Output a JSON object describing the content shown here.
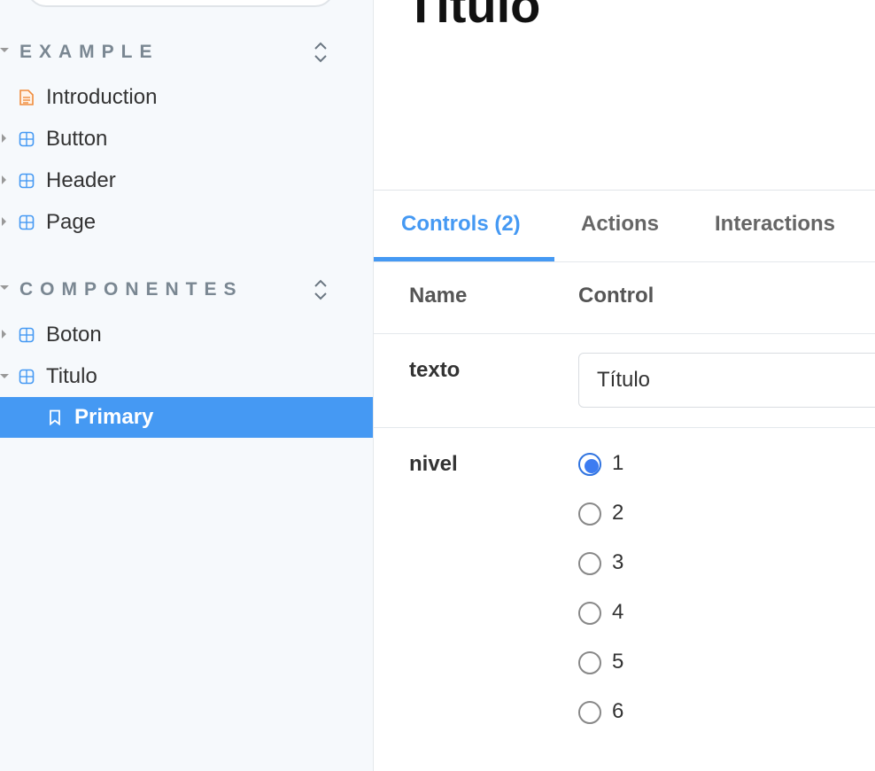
{
  "sidebar": {
    "groups": [
      {
        "title": "EXAMPLE",
        "items": [
          {
            "label": "Introduction",
            "type": "document-icon"
          },
          {
            "label": "Button",
            "type": "component-icon"
          },
          {
            "label": "Header",
            "type": "component-icon"
          },
          {
            "label": "Page",
            "type": "component-icon"
          }
        ]
      },
      {
        "title": "COMPONENTES",
        "items": [
          {
            "label": "Boton",
            "type": "component-icon"
          },
          {
            "label": "Titulo",
            "type": "component-icon"
          },
          {
            "label": "Primary",
            "type": "bookmark-icon",
            "selected": true
          }
        ]
      }
    ]
  },
  "main": {
    "story_title": "Título",
    "tabs": [
      {
        "label": "Controls (2)",
        "active": true
      },
      {
        "label": "Actions"
      },
      {
        "label": "Interactions"
      }
    ],
    "table": {
      "headers": [
        "Name",
        "Control"
      ],
      "rows": [
        {
          "name": "texto",
          "value": "Título"
        },
        {
          "name": "nivel",
          "options": [
            "1",
            "2",
            "3",
            "4",
            "5",
            "6"
          ],
          "selected": "1"
        }
      ]
    }
  },
  "colors": {
    "accent": "#4599f3",
    "sidebar_bg": "#f6f9fc",
    "document_icon": "#f08c3c",
    "component_icon": "#4599f3"
  }
}
